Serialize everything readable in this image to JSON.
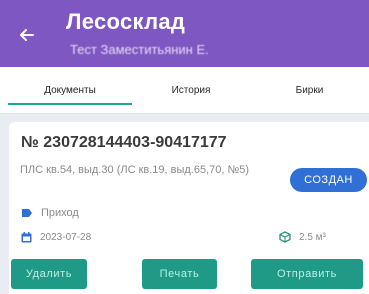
{
  "header": {
    "title": "Лесосклад",
    "subtitle": "Тест Заместитьянин Е.",
    "back_icon": "arrow-left-icon",
    "color": "#7e57c2"
  },
  "tabs": [
    {
      "label": "Документы",
      "active": true
    },
    {
      "label": "История",
      "active": false
    },
    {
      "label": "Бирки",
      "active": false
    }
  ],
  "document": {
    "number": "№ 230728144403-90417177",
    "address": "ПЛС кв.54, выд.30 (ЛС кв.19, выд.65,70, №5)",
    "status": "СОЗДАН",
    "type_label": "Приход",
    "date": "2023-07-28",
    "volume": "2.5 м³"
  },
  "actions": {
    "delete_label": "Удалить",
    "print_label": "Печать",
    "send_label": "Отправить"
  },
  "colors": {
    "accent": "#1ea58f",
    "button": "#1e9a86",
    "badge": "#2f6fd6"
  }
}
